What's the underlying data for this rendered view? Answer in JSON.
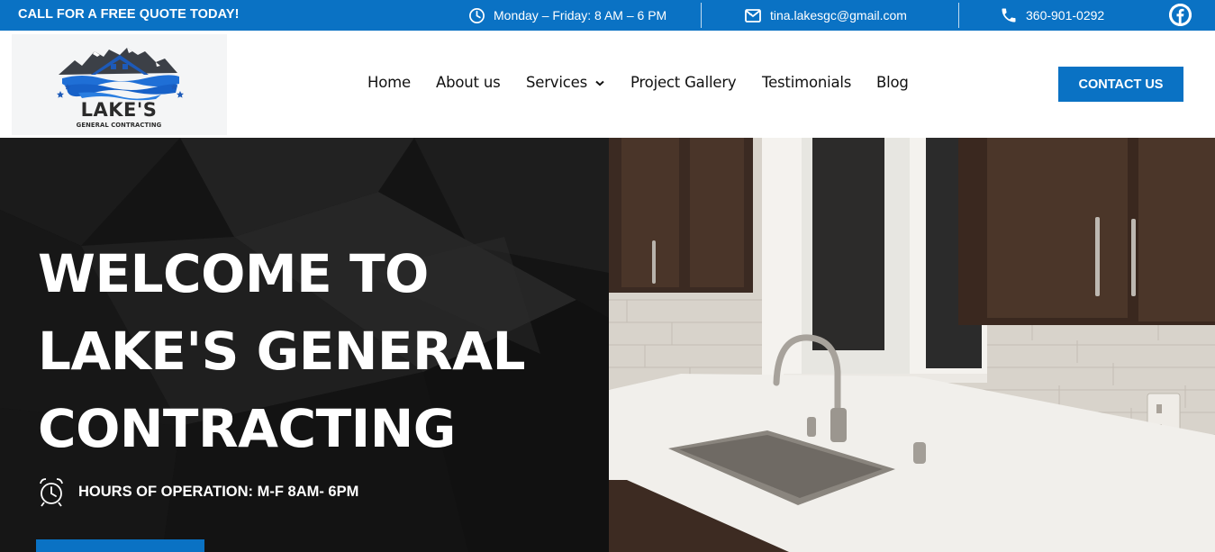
{
  "topbar": {
    "cta": "CALL FOR A FREE QUOTE TODAY!",
    "hours": "Monday – Friday: 8 AM – 6 PM",
    "email": "tina.lakesgc@gmail.com",
    "phone": "360-901-0292",
    "icons": [
      "clock-icon",
      "envelope-icon",
      "phone-icon",
      "facebook-icon"
    ]
  },
  "logo": {
    "title": "LAKE'S",
    "subtitle": "GENERAL CONTRACTING"
  },
  "nav": {
    "items": [
      {
        "label": "Home"
      },
      {
        "label": "About us"
      },
      {
        "label": "Services",
        "has_dropdown": true
      },
      {
        "label": "Project Gallery"
      },
      {
        "label": "Testimonials"
      },
      {
        "label": "Blog"
      }
    ],
    "contact_label": "CONTACT US"
  },
  "hero": {
    "title_lines": [
      "WELCOME TO",
      "LAKE'S GENERAL",
      "CONTRACTING"
    ],
    "hours_text": "HOURS OF OPERATION: M-F 8AM- 6PM",
    "image": "kitchen-sink-photo"
  },
  "colors": {
    "brand_blue": "#0a72c4",
    "hero_dark": "#151515",
    "text_dark": "#111111",
    "white": "#ffffff"
  }
}
